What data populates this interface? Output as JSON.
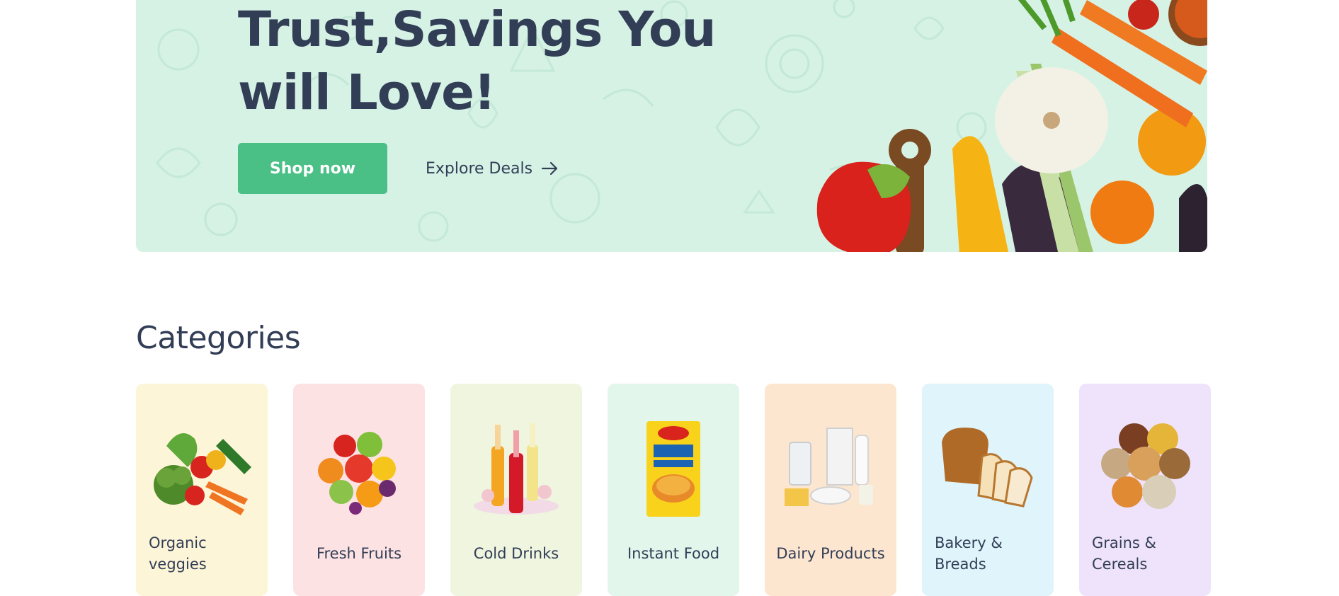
{
  "hero": {
    "title_line1": "Trust,Savings You",
    "title_line2": "will Love!",
    "shop_button": "Shop now",
    "explore_link": "Explore Deals",
    "explore_icon": "arrow-right-icon",
    "colors": {
      "background": "#d6f2e5",
      "button": "#4abf86",
      "text": "#323e56"
    }
  },
  "categories": {
    "title": "Categories",
    "items": [
      {
        "label": "Organic veggies",
        "bg": "#fdf5d8",
        "icon": "vegetables-icon"
      },
      {
        "label": "Fresh Fruits",
        "bg": "#fde2e4",
        "icon": "fruits-icon"
      },
      {
        "label": "Cold Drinks",
        "bg": "#eff5df",
        "icon": "cold-drinks-icon"
      },
      {
        "label": "Instant Food",
        "bg": "#e2f6ec",
        "icon": "instant-noodles-icon"
      },
      {
        "label": "Dairy Products",
        "bg": "#fde6d0",
        "icon": "dairy-icon"
      },
      {
        "label": "Bakery & Breads",
        "bg": "#dff4fb",
        "icon": "bread-icon"
      },
      {
        "label": "Grains & Cereals",
        "bg": "#efe3fb",
        "icon": "grains-icon"
      }
    ]
  }
}
